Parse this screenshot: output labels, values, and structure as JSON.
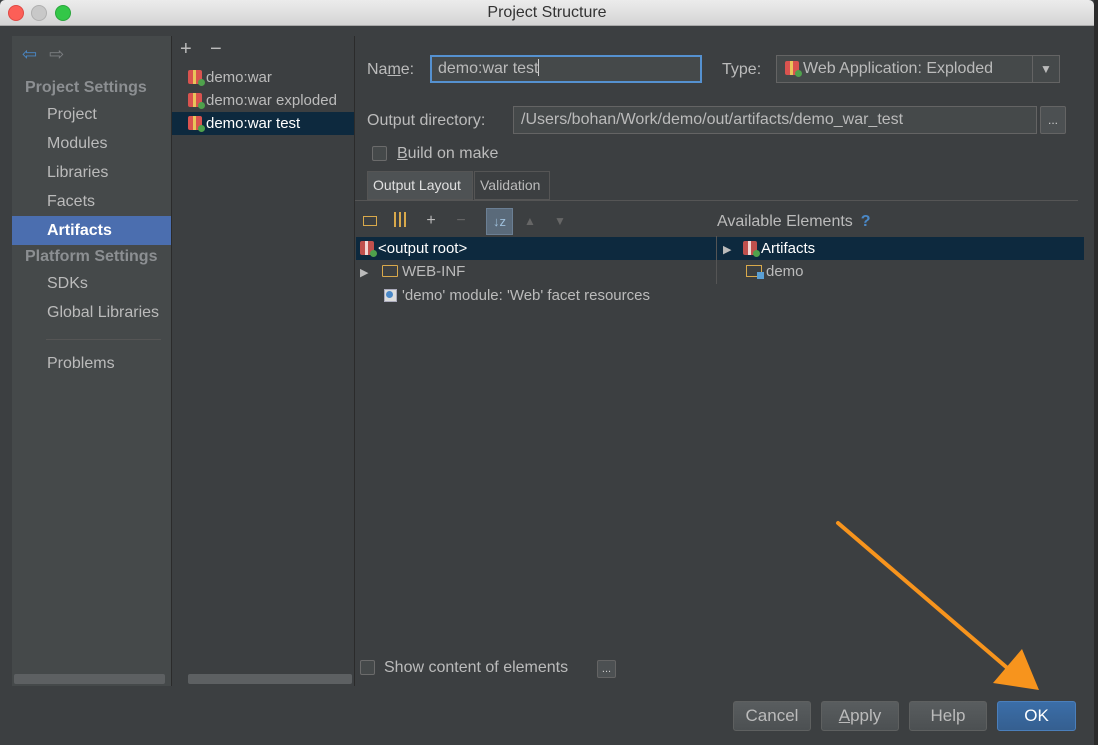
{
  "window": {
    "title": "Project Structure"
  },
  "nav": {
    "project_settings_header": "Project Settings",
    "platform_settings_header": "Platform Settings",
    "items": [
      {
        "label": "Project"
      },
      {
        "label": "Modules"
      },
      {
        "label": "Libraries"
      },
      {
        "label": "Facets"
      },
      {
        "label": "Artifacts",
        "selected": true
      },
      {
        "label": "SDKs"
      },
      {
        "label": "Global Libraries"
      },
      {
        "label": "Problems"
      }
    ]
  },
  "artifacts": {
    "add_label": "+",
    "remove_label": "−",
    "items": [
      {
        "label": "demo:war"
      },
      {
        "label": "demo:war exploded"
      },
      {
        "label": "demo:war test",
        "selected": true
      }
    ]
  },
  "form": {
    "name_label_pre": "Na",
    "name_label_mnemonic": "m",
    "name_label_post": "e:",
    "name_value": "demo:war test",
    "type_label": "Type:",
    "type_value": "Web Application: Exploded",
    "output_dir_label": "Output directory:",
    "output_dir_value": "/Users/bohan/Work/demo/out/artifacts/demo_war_test",
    "browse_label": "...",
    "build_on_make_mnemonic": "B",
    "build_on_make_rest": "uild on make",
    "build_on_make_checked": false
  },
  "tabs": [
    {
      "label": "Output Layout",
      "selected": true
    },
    {
      "label": "Validation"
    }
  ],
  "layout_toolbar": {
    "add_label": "+",
    "remove_label": "−"
  },
  "output_tree": [
    {
      "label": "<output root>",
      "selected": true
    },
    {
      "label": "WEB-INF",
      "expandable": true
    },
    {
      "label": "'demo' module: 'Web' facet resources"
    }
  ],
  "available": {
    "header": "Available Elements",
    "help": "?",
    "items": [
      {
        "label": "Artifacts",
        "selected": true,
        "expandable": true
      },
      {
        "label": "demo"
      }
    ]
  },
  "show_content": {
    "label": "Show content of elements",
    "checked": false,
    "more_label": "..."
  },
  "buttons": {
    "cancel": "Cancel",
    "apply_mnemonic": "A",
    "apply_rest": "pply",
    "help": "Help",
    "ok": "OK"
  },
  "colors": {
    "background": "#3c3f41",
    "selection": "#4b6eaf",
    "tree_selection": "#0d293e",
    "arrow": "#f7941d"
  }
}
